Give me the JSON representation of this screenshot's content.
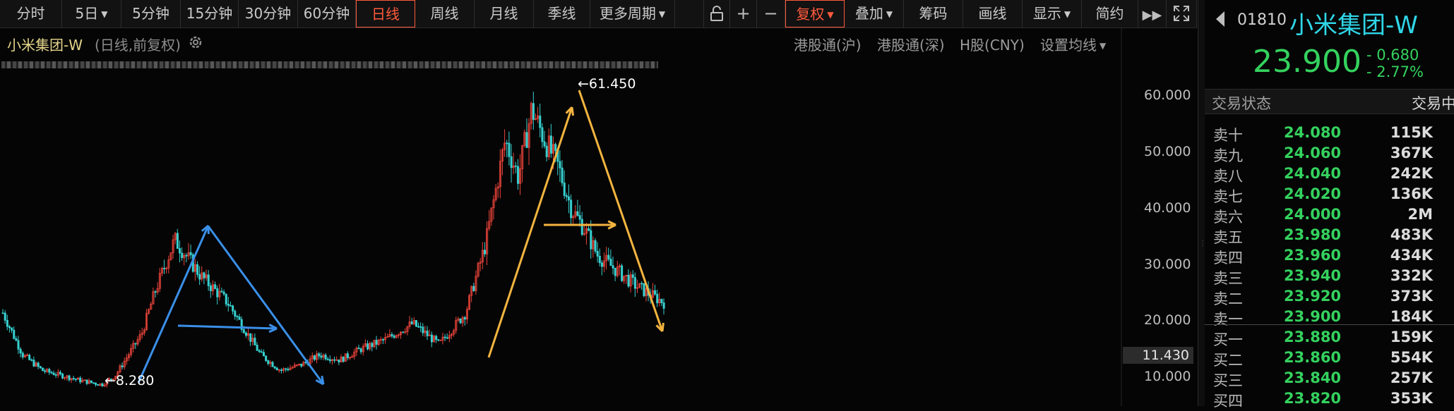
{
  "toolbar": {
    "timeframes": [
      "分时",
      "5日",
      "5分钟",
      "15分钟",
      "30分钟",
      "60分钟",
      "日线",
      "周线",
      "月线",
      "季线",
      "更多周期"
    ],
    "active_timeframe": "日线",
    "tools": [
      "复权",
      "叠加",
      "筹码",
      "画线",
      "显示",
      "简约"
    ],
    "icons": [
      "unlock-icon",
      "plus-icon",
      "minus-icon",
      "fast-forward-icon",
      "fullscreen-icon"
    ]
  },
  "chart": {
    "title": "小米集团-W",
    "subtitle": "(日线,前复权)",
    "links": [
      "港股通(沪)",
      "港股通(深)",
      "H股(CNY)",
      "设置均线"
    ],
    "current_price_tag": "11.430",
    "high_label": "61.450",
    "low_label": "8.280",
    "colors": {
      "up": "#e8433a",
      "down": "#37d0d0",
      "blue_annotation": "#3a8fe8",
      "orange_annotation": "#f3b43f"
    }
  },
  "chart_data": {
    "type": "candlestick",
    "yticks": [
      "60.000",
      "50.000",
      "40.000",
      "30.000",
      "20.000",
      "10.000"
    ],
    "ylim": [
      5,
      67
    ],
    "annotations": {
      "high": 61.45,
      "low": 8.28,
      "last": 11.43
    },
    "trend_x": [
      0.0,
      0.03,
      0.06,
      0.09,
      0.12,
      0.15,
      0.17,
      0.19,
      0.21,
      0.23,
      0.26,
      0.3,
      0.34,
      0.37,
      0.39,
      0.42,
      0.45,
      0.48,
      0.51,
      0.54,
      0.58,
      0.62,
      0.66,
      0.7,
      0.73,
      0.76,
      0.78,
      0.8,
      0.82,
      0.84,
      0.86,
      0.88,
      0.9,
      0.93,
      0.96,
      1.0
    ],
    "trend_y": [
      22,
      14,
      11,
      10,
      9,
      8.3,
      10,
      14,
      18,
      26,
      36,
      29,
      24,
      18,
      14,
      11,
      12,
      14,
      13,
      15,
      17,
      20,
      16,
      22,
      35,
      55,
      48,
      61,
      55,
      50,
      42,
      38,
      33,
      30,
      27,
      24
    ]
  },
  "quote": {
    "code": "01810",
    "name": "小米集团-W",
    "price": "23.900",
    "change": "- 0.680",
    "change_pct": "- 2.77%",
    "status_label": "交易状态",
    "status_value": "交易中"
  },
  "orderbook": {
    "asks": [
      {
        "label": "卖十",
        "price": "24.080",
        "volume": "115K"
      },
      {
        "label": "卖九",
        "price": "24.060",
        "volume": "367K"
      },
      {
        "label": "卖八",
        "price": "24.040",
        "volume": "242K"
      },
      {
        "label": "卖七",
        "price": "24.020",
        "volume": "136K"
      },
      {
        "label": "卖六",
        "price": "24.000",
        "volume": "2M"
      },
      {
        "label": "卖五",
        "price": "23.980",
        "volume": "483K"
      },
      {
        "label": "卖四",
        "price": "23.960",
        "volume": "434K"
      },
      {
        "label": "卖三",
        "price": "23.940",
        "volume": "332K"
      },
      {
        "label": "卖二",
        "price": "23.920",
        "volume": "373K"
      },
      {
        "label": "卖一",
        "price": "23.900",
        "volume": "184K"
      }
    ],
    "bids": [
      {
        "label": "买一",
        "price": "23.880",
        "volume": "159K"
      },
      {
        "label": "买二",
        "price": "23.860",
        "volume": "554K"
      },
      {
        "label": "买三",
        "price": "23.840",
        "volume": "257K"
      },
      {
        "label": "买四",
        "price": "23.820",
        "volume": "353K"
      }
    ]
  }
}
